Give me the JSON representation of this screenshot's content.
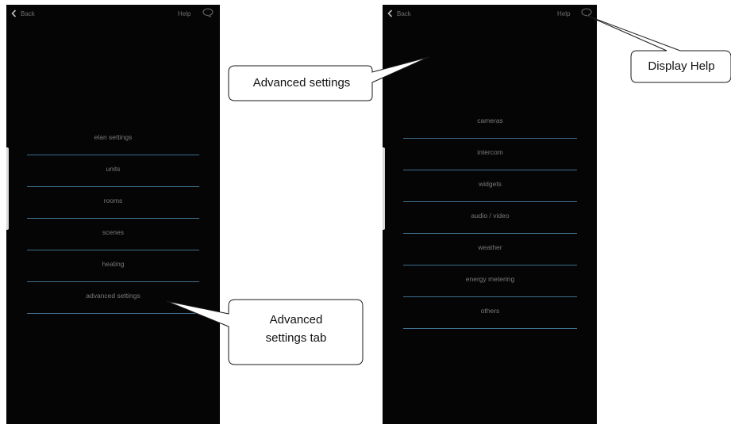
{
  "left_screen": {
    "back_label": "Back",
    "help_label": "Help",
    "menu": [
      "elan settings",
      "units",
      "rooms",
      "scenes",
      "heating",
      "advanced settings"
    ]
  },
  "right_screen": {
    "back_label": "Back",
    "help_label": "Help",
    "menu": [
      "cameras",
      "intercom",
      "widgets",
      "audio / video",
      "weather",
      "energy metering",
      "others"
    ]
  },
  "callouts": {
    "advanced_settings": "Advanced settings",
    "display_help": "Display Help",
    "advanced_tab_line1": "Advanced",
    "advanced_tab_line2": "settings tab"
  },
  "colors": {
    "screen_bg": "#050505",
    "divider": "#3f6f8e",
    "menu_text": "#7a7a7a"
  }
}
